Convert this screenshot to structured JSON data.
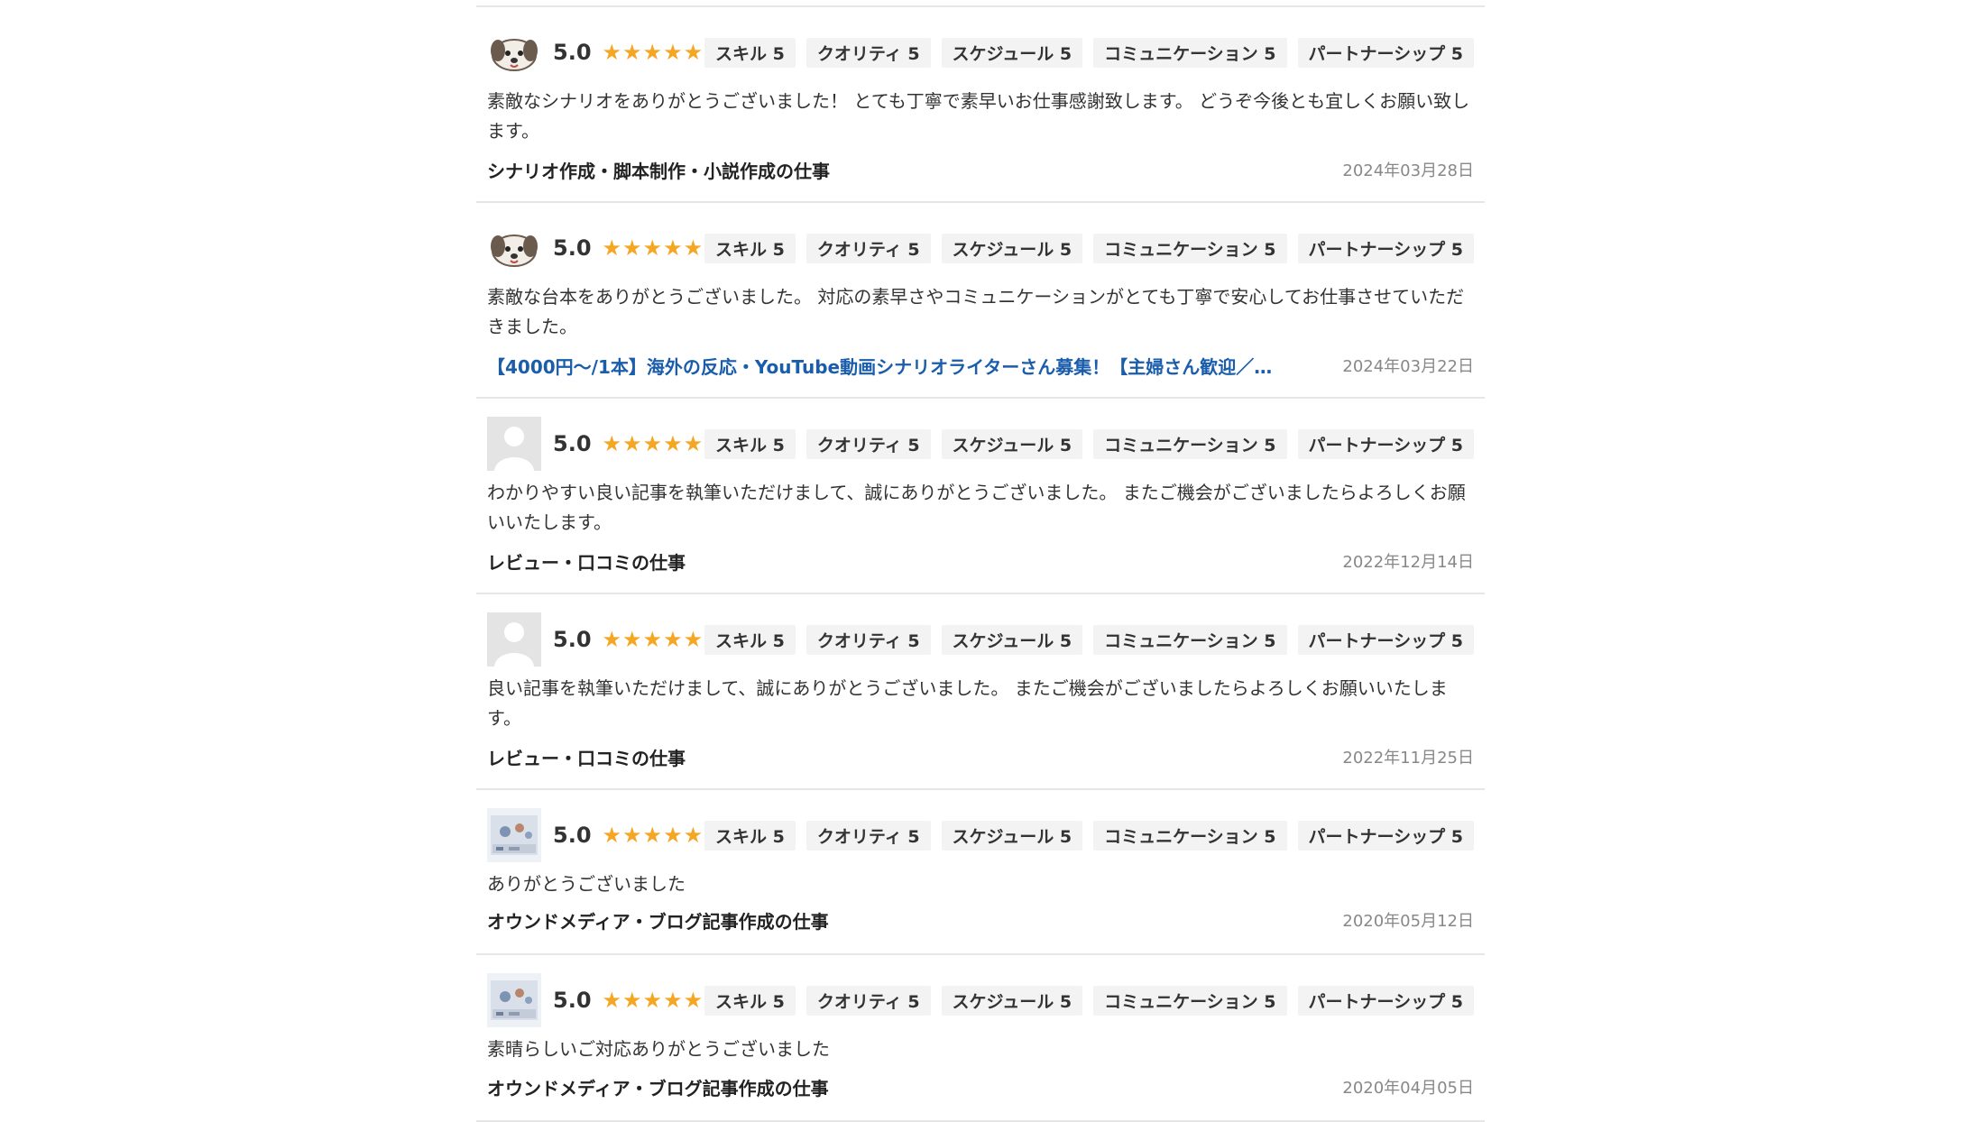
{
  "reviews": [
    {
      "avatar": "dog-avatar",
      "score": "5.0",
      "stars": "★★★★★",
      "tags": [
        "スキル 5",
        "クオリティ 5",
        "スケジュール 5",
        "コミュニケーション 5",
        "パートナーシップ 5"
      ],
      "comment": "素敵なシナリオをありがとうございました！ とても丁寧で素早いお仕事感謝致します。 どうぞ今後とも宜しくお願い致します。",
      "job": "シナリオ作成・脚本制作・小説作成の仕事",
      "job_is_link": false,
      "date": "2024年03月28日"
    },
    {
      "avatar": "dog-avatar",
      "score": "5.0",
      "stars": "★★★★★",
      "tags": [
        "スキル 5",
        "クオリティ 5",
        "スケジュール 5",
        "コミュニケーション 5",
        "パートナーシップ 5"
      ],
      "comment": "素敵な台本をありがとうございました。 対応の素早さやコミュニケーションがとても丁寧で安心してお仕事させていただきました。",
      "job": "【4000円〜/1本】海外の反応・YouTube動画シナリオライターさん募集！【主婦さん歓迎／…",
      "job_is_link": true,
      "date": "2024年03月22日"
    },
    {
      "avatar": "default-avatar",
      "score": "5.0",
      "stars": "★★★★★",
      "tags": [
        "スキル 5",
        "クオリティ 5",
        "スケジュール 5",
        "コミュニケーション 5",
        "パートナーシップ 5"
      ],
      "comment": "わかりやすい良い記事を執筆いただけまして、誠にありがとうございました。 またご機会がございましたらよろしくお願いいたします。",
      "job": "レビュー・口コミの仕事",
      "job_is_link": false,
      "date": "2022年12月14日"
    },
    {
      "avatar": "default-avatar",
      "score": "5.0",
      "stars": "★★★★★",
      "tags": [
        "スキル 5",
        "クオリティ 5",
        "スケジュール 5",
        "コミュニケーション 5",
        "パートナーシップ 5"
      ],
      "comment": "良い記事を執筆いただけまして、誠にありがとうございました。 またご機会がございましたらよろしくお願いいたします。",
      "job": "レビュー・口コミの仕事",
      "job_is_link": false,
      "date": "2022年11月25日"
    },
    {
      "avatar": "photo-avatar",
      "score": "5.0",
      "stars": "★★★★★",
      "tags": [
        "スキル 5",
        "クオリティ 5",
        "スケジュール 5",
        "コミュニケーション 5",
        "パートナーシップ 5"
      ],
      "comment": "ありがとうございました",
      "job": "オウンドメディア・ブログ記事作成の仕事",
      "job_is_link": false,
      "date": "2020年05月12日"
    },
    {
      "avatar": "photo-avatar",
      "score": "5.0",
      "stars": "★★★★★",
      "tags": [
        "スキル 5",
        "クオリティ 5",
        "スケジュール 5",
        "コミュニケーション 5",
        "パートナーシップ 5"
      ],
      "comment": "素晴らしいご対応ありがとうございました",
      "job": "オウンドメディア・ブログ記事作成の仕事",
      "job_is_link": false,
      "date": "2020年04月05日"
    }
  ],
  "colors": {
    "star": "#f5a623",
    "link": "#1a5dab",
    "divider": "#e6e6e6",
    "tag_bg": "#f3f3f3"
  }
}
